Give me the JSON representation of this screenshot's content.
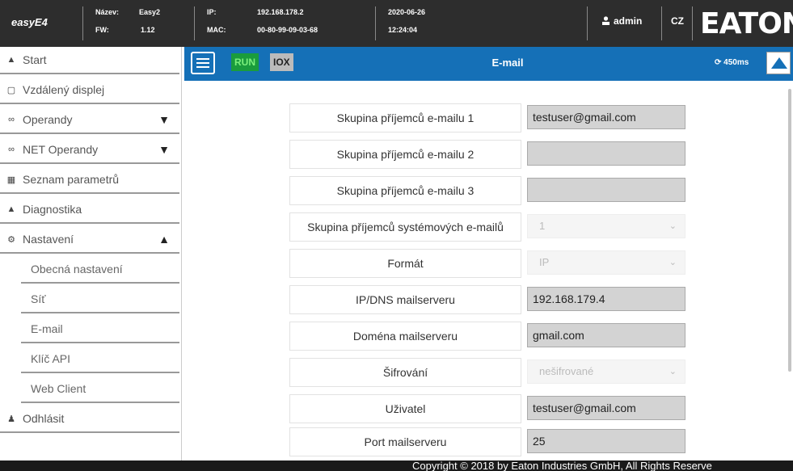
{
  "header": {
    "brand": "easyE4",
    "name_label": "Název:",
    "name_value": "Easy2",
    "fw_label": "FW:",
    "fw_value": "1.12",
    "ip_label": "IP:",
    "ip_value": "192.168.178.2",
    "mac_label": "MAC:",
    "mac_value": "00-80-99-09-03-68",
    "date": "2020-06-26",
    "time": "12:24:04",
    "user": "admin",
    "language": "CZ",
    "logo": "EATON"
  },
  "sidebar": {
    "items": [
      {
        "label": "Start",
        "icon": "home-icon"
      },
      {
        "label": "Vzdálený displej",
        "icon": "monitor-icon"
      },
      {
        "label": "Operandy",
        "icon": "link-icon"
      },
      {
        "label": "NET Operandy",
        "icon": "link-icon"
      },
      {
        "label": "Seznam parametrů",
        "icon": "list-icon"
      },
      {
        "label": "Diagnostika",
        "icon": "warning-icon"
      },
      {
        "label": "Nastavení",
        "icon": "gear-icon"
      },
      {
        "label": "Odhlásit",
        "icon": "user-icon"
      }
    ],
    "settings_sub": [
      "Obecná nastavení",
      "Síť",
      "E-mail",
      "Klíč API",
      "Web Client"
    ]
  },
  "titlebar": {
    "run": "RUN",
    "iox": "IOX",
    "title": "E-mail",
    "cycle": "450ms"
  },
  "form": {
    "rows": [
      {
        "label": "Skupina příjemců e-mailu 1",
        "value": "testuser@gmail.com"
      },
      {
        "label": "Skupina příjemců e-mailu 2",
        "value": ""
      },
      {
        "label": "Skupina příjemců e-mailu 3",
        "value": ""
      },
      {
        "label": "Skupina příjemců systémových e-mailů",
        "value": "1"
      },
      {
        "label": "Formát",
        "value": "IP"
      },
      {
        "label": "IP/DNS mailserveru",
        "value": "192.168.179.4"
      },
      {
        "label": "Doména mailserveru",
        "value": "gmail.com"
      },
      {
        "label": "Šifrování",
        "value": "nešifrované"
      },
      {
        "label": "Uživatel",
        "value": "testuser@gmail.com"
      },
      {
        "label": "Port mailserveru",
        "value": "25"
      }
    ]
  },
  "footer": {
    "copyright": "Copyright © 2018 by Eaton Industries GmbH, All Rights Reserve"
  },
  "colors": {
    "header_bg": "#2d2d2d",
    "titlebar_bg": "#1570b7",
    "run_green": "#1a9c3c"
  }
}
